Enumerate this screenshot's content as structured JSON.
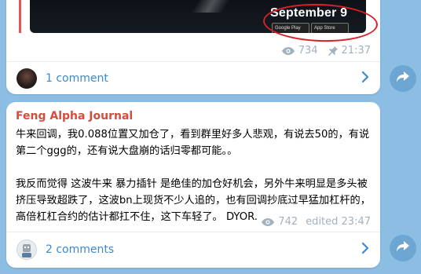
{
  "post1": {
    "media_date": "September 9",
    "badge_google_play": "Google Play",
    "badge_app_store": "App Store",
    "views": "734",
    "time": "21:37",
    "comments": "1 comment"
  },
  "post2": {
    "author": "Feng Alpha Journal",
    "body": "牛来回调，我0.088位置又加仓了，看到群里好多人悲观，有说去50的，有说第二个ggg的，还有说大盘崩的话归零都可能。。\n\n我反而觉得 这波牛来 暴力插针 是绝佳的加仓好机会，另外牛来明显是多头被挤压导致超跌了，这波bn上现货不少人追的，也有回调抄底过早猛加杠杆的，高倍杠杠合约的估计都扛不住，这下车轻了。 DYOR.",
    "views": "742",
    "time": "edited 23:47",
    "comments": "2 comments"
  },
  "colors": {
    "background": "#8cbde3",
    "author": "#d64b3c",
    "link": "#3a8ad0",
    "meta": "#a3b1bd",
    "annotation": "#d8202a"
  },
  "icons": {
    "views": "eye-icon",
    "pin": "pin-icon",
    "chevron": "chevron-right-icon",
    "share": "share-arrow-icon"
  }
}
